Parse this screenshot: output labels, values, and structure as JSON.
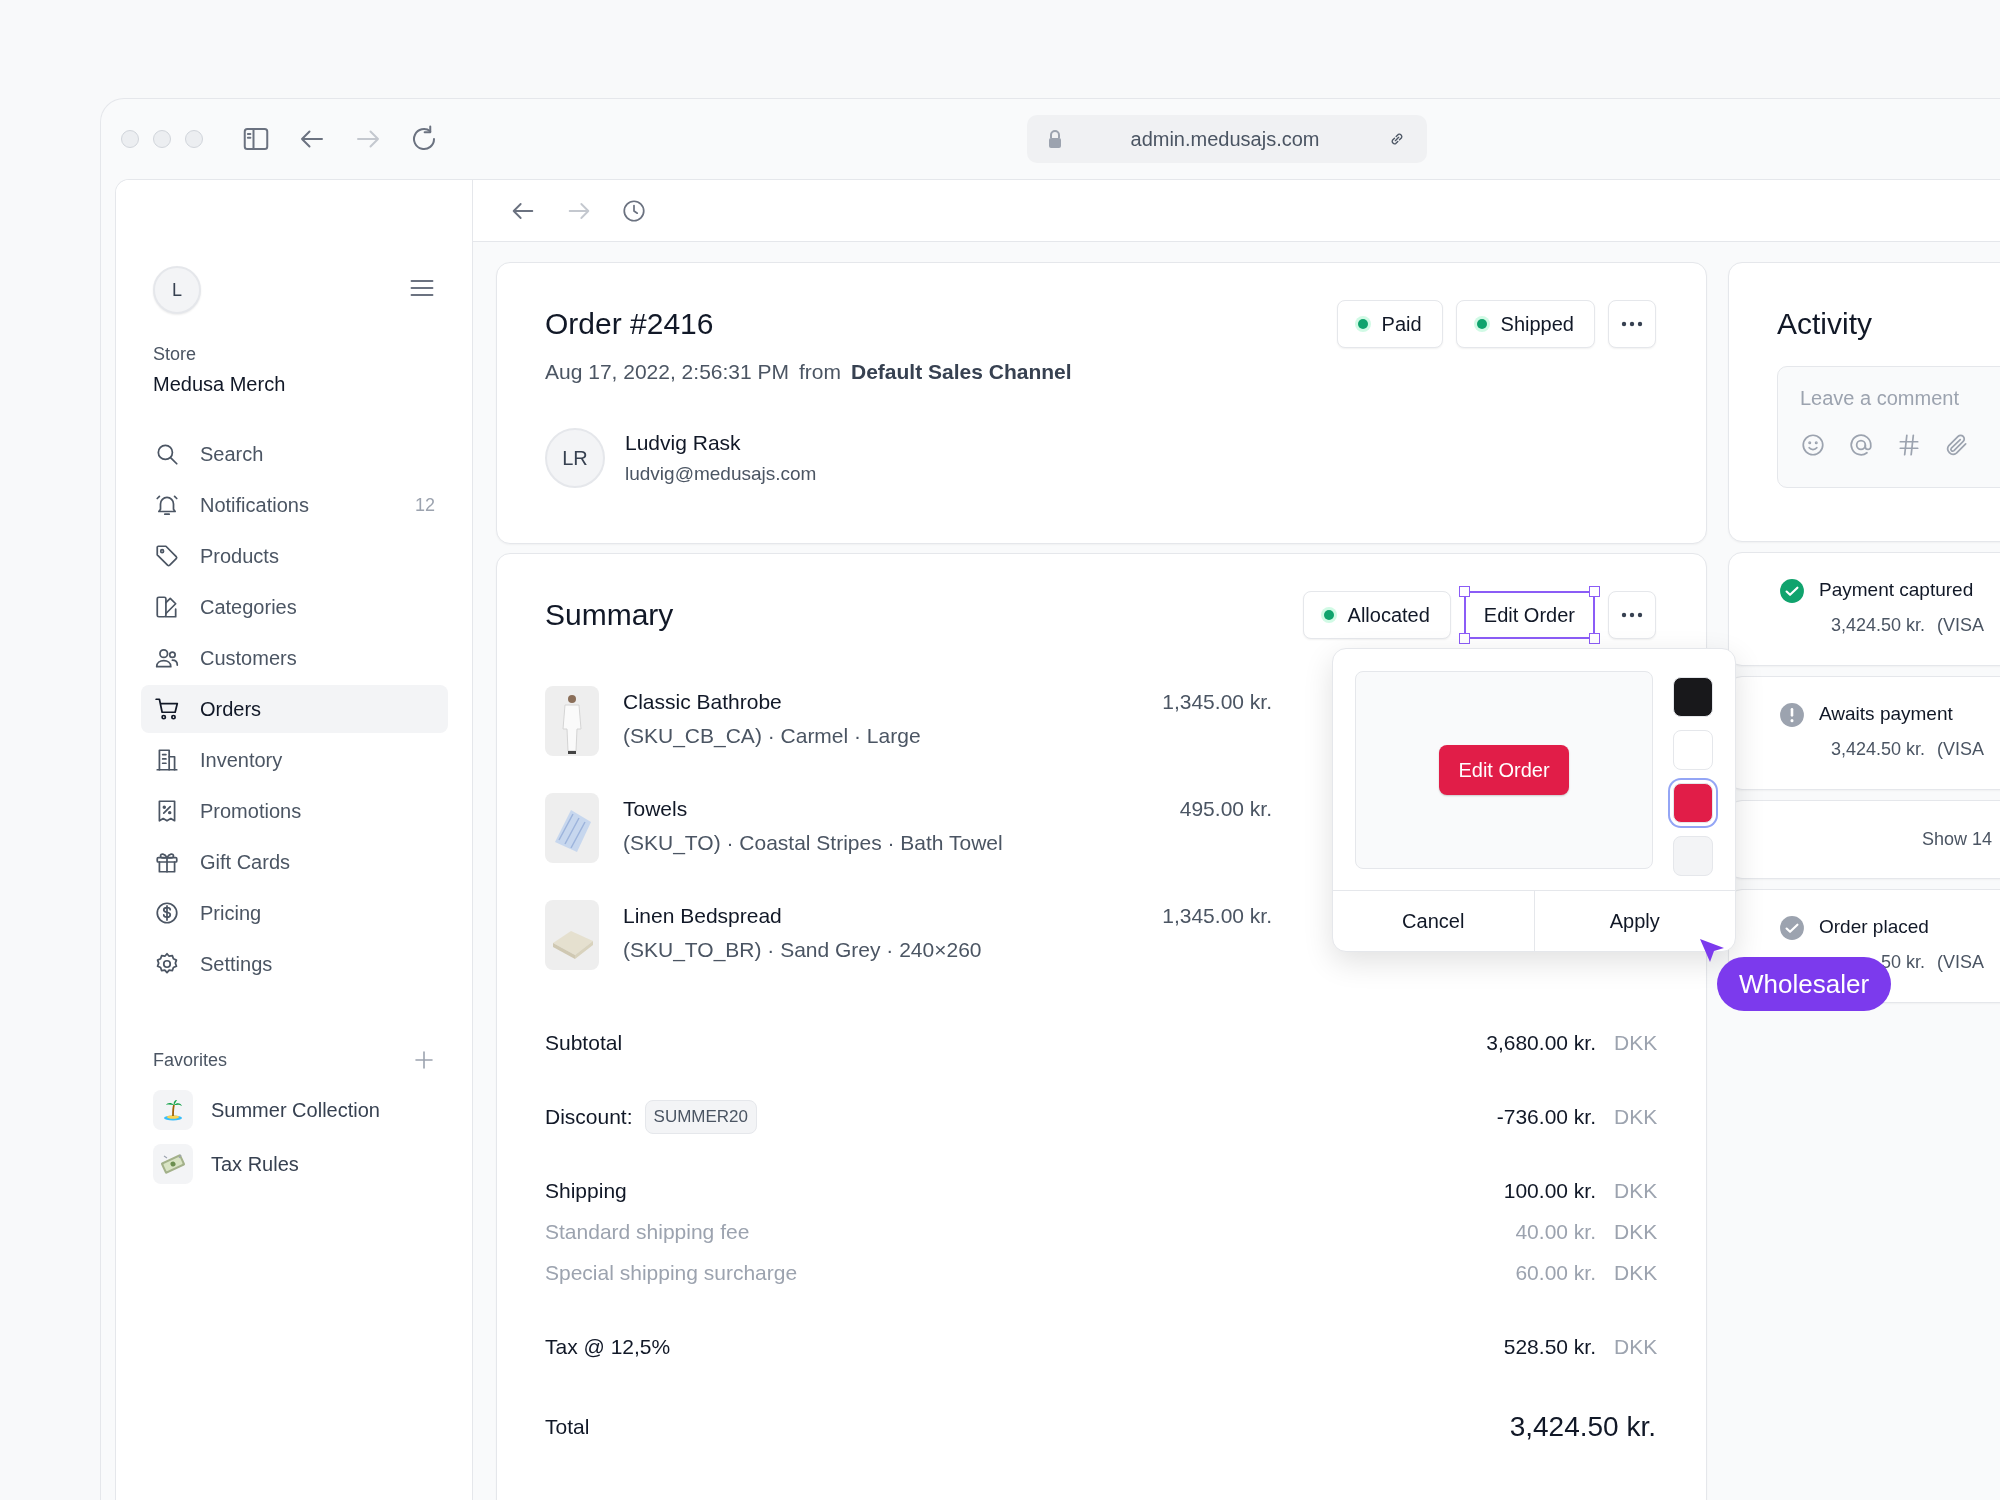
{
  "browser": {
    "url": "admin.medusajs.com"
  },
  "sidebar": {
    "avatar": "L",
    "store_label": "Store",
    "store_name": "Medusa Merch",
    "nav": [
      {
        "label": "Search",
        "selected": false
      },
      {
        "label": "Notifications",
        "badge": "12",
        "selected": false
      },
      {
        "label": "Products",
        "selected": false
      },
      {
        "label": "Categories",
        "selected": false
      },
      {
        "label": "Customers",
        "selected": false
      },
      {
        "label": "Orders",
        "selected": true
      },
      {
        "label": "Inventory",
        "selected": false
      },
      {
        "label": "Promotions",
        "selected": false
      },
      {
        "label": "Gift Cards",
        "selected": false
      },
      {
        "label": "Pricing",
        "selected": false
      },
      {
        "label": "Settings",
        "selected": false
      }
    ],
    "favorites_title": "Favorites",
    "favorites": [
      {
        "label": "Summer Collection"
      },
      {
        "label": "Tax Rules"
      }
    ]
  },
  "order": {
    "title": "Order #2416",
    "date": "Aug 17, 2022, 2:56:31 PM",
    "from_label": "from",
    "channel": "Default Sales Channel",
    "badges": [
      {
        "label": "Paid"
      },
      {
        "label": "Shipped"
      }
    ],
    "customer": {
      "initials": "LR",
      "name": "Ludvig Rask",
      "email": "ludvig@medusajs.com"
    }
  },
  "summary": {
    "title": "Summary",
    "status": "Allocated",
    "edit_button": "Edit Order",
    "items": [
      {
        "name": "Classic Bathrobe",
        "variant": "(SKU_CB_CA) · Carmel · Large",
        "price": "1,345.00 kr."
      },
      {
        "name": "Towels",
        "variant": "(SKU_TO) · Coastal Stripes · Bath Towel",
        "price": "495.00 kr."
      },
      {
        "name": "Linen Bedspread",
        "variant": "(SKU_TO_BR) · Sand Grey · 240×260",
        "price": "1,345.00 kr."
      }
    ],
    "lines": [
      {
        "kind": "main",
        "label": "Subtotal",
        "amount": "3,680.00 kr.",
        "currency": "DKK"
      },
      {
        "kind": "discount",
        "label": "Discount:",
        "code": "SUMMER20",
        "amount": "-736.00 kr.",
        "currency": "DKK"
      },
      {
        "kind": "main",
        "label": "Shipping",
        "amount": "100.00 kr.",
        "currency": "DKK"
      },
      {
        "kind": "sub",
        "label": "Standard shipping fee",
        "amount": "40.00 kr.",
        "currency": "DKK"
      },
      {
        "kind": "sub",
        "label": "Special shipping surcharge",
        "amount": "60.00 kr.",
        "currency": "DKK"
      },
      {
        "kind": "main",
        "label": "Tax @ 12,5%",
        "amount": "528.50 kr.",
        "currency": "DKK"
      }
    ],
    "total": {
      "label": "Total",
      "amount": "3,424.50 kr."
    }
  },
  "popover": {
    "preview_button": "Edit Order",
    "swatches": [
      {
        "color": "#18181b",
        "selected": false
      },
      {
        "color": "#ffffff",
        "selected": false
      },
      {
        "color": "#e11d48",
        "selected": true
      },
      {
        "color": "#f3f4f6",
        "selected": false
      }
    ],
    "cancel": "Cancel",
    "apply": "Apply"
  },
  "activity": {
    "title": "Activity",
    "comment_placeholder": "Leave a comment",
    "events": [
      {
        "kind": "success",
        "title": "Payment captured",
        "amount": "3,424.50 kr.",
        "method": "(VISA"
      },
      {
        "kind": "warning",
        "title": "Awaits payment",
        "amount": "3,424.50 kr.",
        "method": "(VISA"
      },
      {
        "kind": "more",
        "label": "Show 14"
      },
      {
        "kind": "done",
        "title": "Order placed",
        "amount": "50 kr.",
        "method": "(VISA"
      }
    ]
  },
  "cursor": {
    "label": "Wholesaler"
  }
}
